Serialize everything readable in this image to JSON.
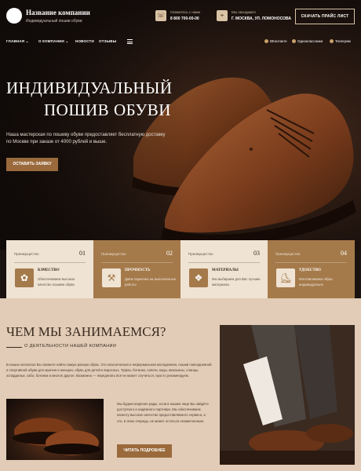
{
  "header": {
    "company": "Название компании",
    "subtitle": "Индивидуальный пошив обуви",
    "phone_label": "Свяжитесь с нами",
    "phone": "8 800 700-00-00",
    "address_label": "Мы находимся",
    "address": "Г. МОСКВА, УЛ. ЛОМОНОСОВА",
    "price_button": "СКАЧАТЬ ПРАЙС ЛИСТ"
  },
  "nav": {
    "items": [
      "ГЛАВНАЯ",
      "О КОМПАНИИ",
      "НОВОСТИ",
      "ОТЗЫВЫ"
    ],
    "social": [
      "ВКонтакте",
      "Одноклассники",
      "Телеграм"
    ]
  },
  "hero": {
    "title_line1": "ИНДИВИДУАЛЬНЫЙ",
    "title_line2": "ПОШИВ ОБУВИ",
    "description": "Наша мастерская по пошиву обуви предоставляет бесплатную доставку по Москве при заказе от 4000 рублей и выше.",
    "cta": "ОСТАВИТЬ ЗАЯВКУ"
  },
  "features": [
    {
      "label": "Преимущество",
      "num": "01",
      "title": "КАЧЕСТВО",
      "text": "Обеспечиваем высокое качество пошива обуви",
      "icon": "quality-badge-icon"
    },
    {
      "label": "Преимущество",
      "num": "02",
      "title": "ПРОЧНОСТЬ",
      "text": "Даём гарантию на выполненные работы",
      "icon": "tools-icon"
    },
    {
      "label": "Преимущество",
      "num": "03",
      "title": "МАТЕРИАЛЫ",
      "text": "Мы выбираем для Вас лучшие материалы",
      "icon": "leather-icon"
    },
    {
      "label": "Преимущество",
      "num": "04",
      "title": "УДОБСТВО",
      "text": "Изготавливаем обувь индивидуально",
      "icon": "shoe-icon"
    }
  ],
  "about": {
    "title": "ЧЕМ МЫ ЗАНИМАЕМСЯ?",
    "subtitle": "О ДЕЯТЕЛЬНОСТИ НАШЕЙ КОМПАНИИ",
    "text": "В наших каталогах Вы сможете найти самую разную обувь. Это классическая и неформальная молодежная, пошив повседневной и спортивной обуви для мужчин и женщин, обувь для детей и взрослых. Туфли, ботинки, сапоги, кеды, мокасины, сланцы, эспадрильи, сабо, ботинки и многое другое. Возможно — переделать всё не может случиться, просто рекомендуем.",
    "text2": "Мы будем искренне рады, если в нашем лице Вы найдёте доступного и надёжного партнёра. Мы обеспечиваем клиенту высокое качество предоставляемого сервиса, а это, в свою очередь, не может остаться незамеченным.",
    "button": "ЧИТАТЬ ПОДРОБНЕЕ"
  },
  "colors": {
    "accent": "#9a6a3c",
    "cream": "#efe3d4",
    "bg_about": "#e2ccb7"
  }
}
